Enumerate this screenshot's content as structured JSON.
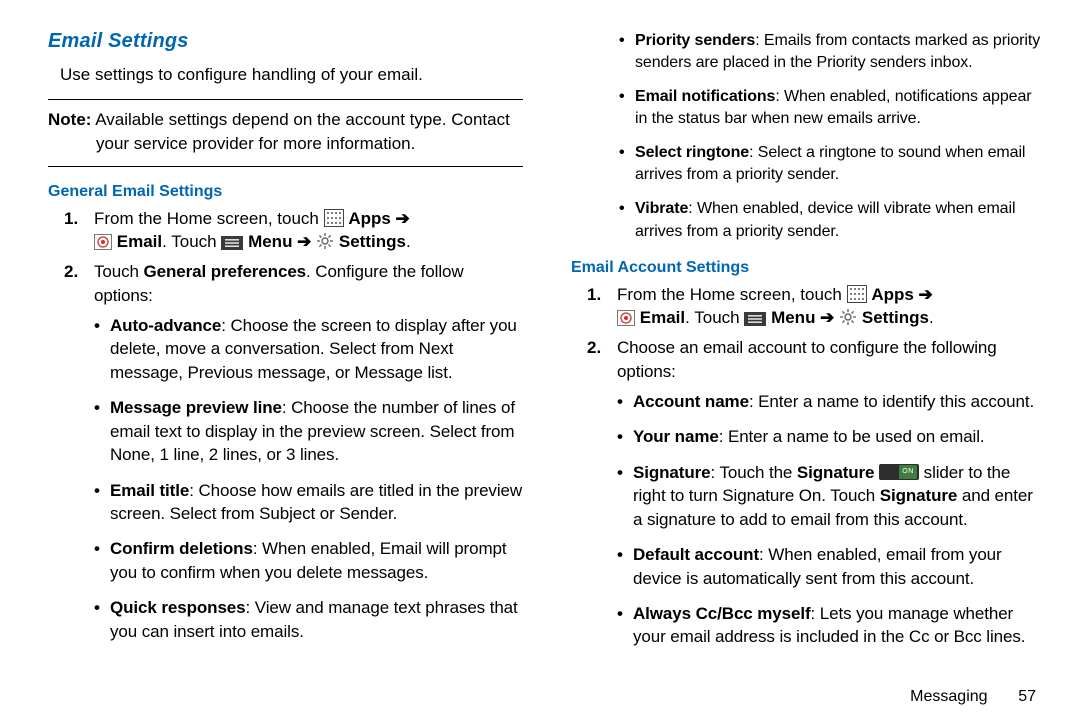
{
  "headings": {
    "email_settings": "Email Settings",
    "general": "General Email Settings",
    "account": "Email Account Settings"
  },
  "lead": "Use settings to configure handling of your email.",
  "note_label": "Note:",
  "note_body": "Available settings depend on the account type. Contact your service provider for more information.",
  "nav": {
    "from_home": "From the Home screen, touch ",
    "apps": "Apps",
    "arrow": " ➔ ",
    "email": "Email",
    "touch": ". Touch ",
    "menu": "Menu",
    "settings": "Settings",
    "period": "."
  },
  "general_step2_a": "Touch ",
  "general_step2_b": "General preferences",
  "general_step2_c": ". Configure the follow options:",
  "general_bullets": [
    {
      "term": "Auto-advance",
      "body": ": Choose the screen to display after you delete, move a conversation. Select from Next message, Previous message, or Message list."
    },
    {
      "term": "Message preview line",
      "body": ": Choose the number of lines of email text to display in the preview screen. Select from None, 1 line, 2 lines, or 3 lines."
    },
    {
      "term": "Email title",
      "body": ": Choose how emails are titled in the preview screen. Select from Subject or Sender."
    },
    {
      "term": "Confirm deletions",
      "body": ": When enabled, Email will prompt you to confirm when you delete messages."
    },
    {
      "term": "Quick responses",
      "body": ": View and manage text phrases that you can insert into emails."
    }
  ],
  "top_bullets": [
    {
      "term": "Priority senders",
      "body": ": Emails from contacts marked as priority senders are placed in the Priority senders inbox."
    },
    {
      "term": "Email notifications",
      "body": ": When enabled, notifications appear in the status bar when new emails arrive."
    },
    {
      "term": "Select ringtone",
      "body": ": Select a ringtone to sound when email arrives from a priority sender."
    },
    {
      "term": "Vibrate",
      "body": ": When enabled, device will vibrate when email arrives from a priority sender."
    }
  ],
  "account_step2": "Choose an email account to configure the following options:",
  "account_bullets_simple": [
    {
      "term": "Account name",
      "body": ": Enter a name to identify this account."
    },
    {
      "term": "Your name",
      "body": ": Enter a name to be used on email."
    }
  ],
  "sig": {
    "term": "Signature",
    "a": ": Touch the ",
    "b": "Signature",
    "c": " slider to the right to turn Signature On. Touch ",
    "d": "Signature",
    "e": " and enter a signature to add to email from this account."
  },
  "account_bullets_rest": [
    {
      "term": "Default account",
      "body": ": When enabled, email from your device is automatically sent from this account."
    },
    {
      "term": "Always Cc/Bcc myself",
      "body": ": Lets you manage whether your email address is included in the Cc or Bcc lines."
    }
  ],
  "footer": {
    "section": "Messaging",
    "page": "57"
  }
}
